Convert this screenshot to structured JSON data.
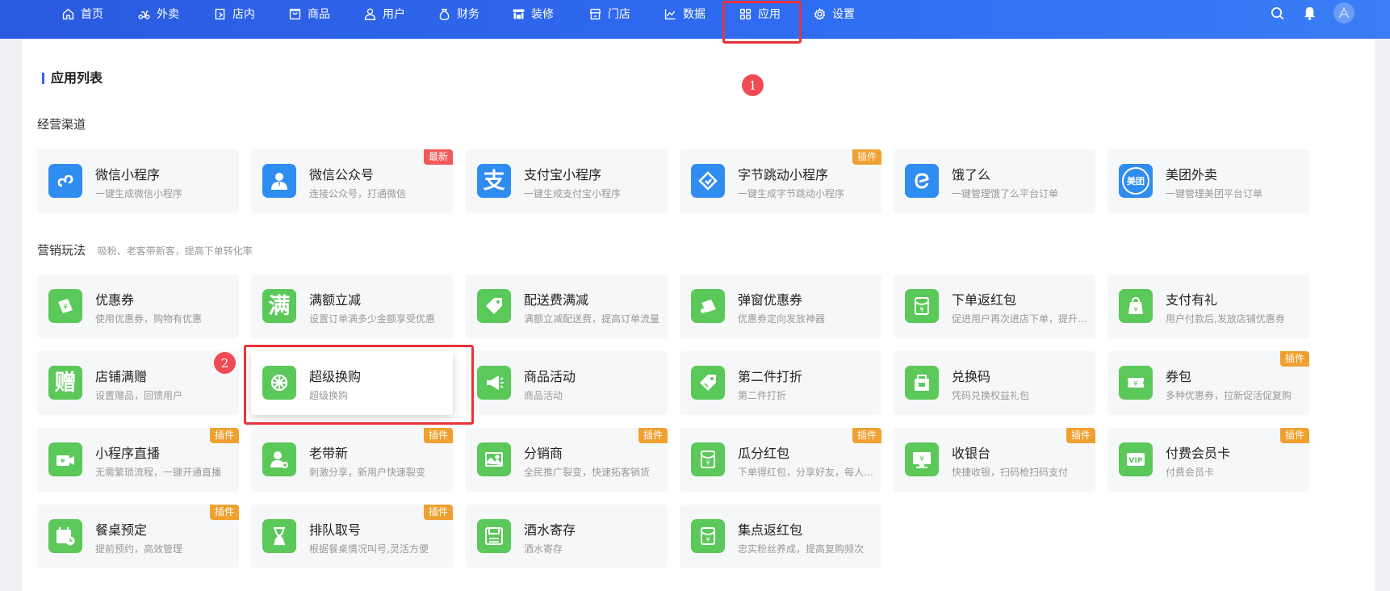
{
  "colors": {
    "nav_bg": "#2f6df2",
    "accent": "#2d66f0",
    "icon_green": "#5bc85a",
    "icon_blue": "#2f8cf0",
    "plugin_badge": "#f0a030",
    "new_badge": "#f05a5a",
    "highlight": "#e8333a"
  },
  "nav": {
    "items": [
      {
        "label": "首页",
        "icon": "home-icon"
      },
      {
        "label": "外卖",
        "icon": "scooter-icon"
      },
      {
        "label": "店内",
        "icon": "store-door-icon"
      },
      {
        "label": "商品",
        "icon": "bag-icon"
      },
      {
        "label": "用户",
        "icon": "user-icon"
      },
      {
        "label": "财务",
        "icon": "money-bag-icon"
      },
      {
        "label": "装修",
        "icon": "shop-decor-icon"
      },
      {
        "label": "门店",
        "icon": "shop-icon"
      },
      {
        "label": "数据",
        "icon": "chart-icon"
      },
      {
        "label": "应用",
        "icon": "apps-grid-icon"
      },
      {
        "label": "设置",
        "icon": "gear-icon"
      }
    ],
    "right_icons": [
      "search-icon",
      "bell-icon",
      "avatar"
    ]
  },
  "steps": [
    "1",
    "2"
  ],
  "page": {
    "title": "应用列表"
  },
  "groups": {
    "channels": {
      "title": "经营渠道",
      "subtitle": "",
      "items": [
        {
          "name": "微信小程序",
          "desc": "一键生成微信小程序",
          "icon": "mini-program-icon",
          "badge": ""
        },
        {
          "name": "微信公众号",
          "desc": "连接公众号，打通微信",
          "icon": "official-account-icon",
          "badge": "最新"
        },
        {
          "name": "支付宝小程序",
          "desc": "一键生成支付宝小程序",
          "icon": "alipay-icon",
          "icon_text": "支",
          "badge": ""
        },
        {
          "name": "字节跳动小程序",
          "desc": "一键生成字节跳动小程序",
          "icon": "bytedance-icon",
          "badge": "插件"
        },
        {
          "name": "饿了么",
          "desc": "一键管理饿了么平台订单",
          "icon": "eleme-icon",
          "badge": ""
        },
        {
          "name": "美团外卖",
          "desc": "一键管理美团平台订单",
          "icon": "meituan-icon",
          "icon_text": "美团",
          "badge": ""
        }
      ]
    },
    "marketing": {
      "title": "营销玩法",
      "subtitle": "吸粉、老客带新客，提高下单转化率",
      "items": [
        {
          "name": "优惠券",
          "desc": "使用优惠券，购物有优惠",
          "icon": "coupon-icon",
          "badge": ""
        },
        {
          "name": "满额立减",
          "desc": "设置订单满多少金额享受优惠",
          "icon": "full-reduction-icon",
          "icon_text": "满",
          "badge": ""
        },
        {
          "name": "配送费满减",
          "desc": "满额立减配送费，提高订单流量",
          "icon": "delivery-tag-icon",
          "badge": ""
        },
        {
          "name": "弹窗优惠券",
          "desc": "优惠券定向发放神器",
          "icon": "popup-coupon-icon",
          "badge": ""
        },
        {
          "name": "下单返红包",
          "desc": "促进用户再次进店下单，提升复购",
          "icon": "red-envelope-icon",
          "badge": ""
        },
        {
          "name": "支付有礼",
          "desc": "用户付款后,发放店铺优惠券",
          "icon": "gift-bag-icon",
          "badge": ""
        },
        {
          "name": "店铺满赠",
          "desc": "设置赠品，回馈用户",
          "icon": "gift-text-icon",
          "icon_text": "赠",
          "badge": ""
        },
        {
          "name": "超级换购",
          "desc": "超级换购",
          "icon": "wheel-icon",
          "badge": ""
        },
        {
          "name": "商品活动",
          "desc": "商品活动",
          "icon": "megaphone-icon",
          "badge": ""
        },
        {
          "name": "第二件打折",
          "desc": "第二件打折",
          "icon": "price-tag-icon",
          "badge": ""
        },
        {
          "name": "兑换码",
          "desc": "凭码兑换权益礼包",
          "icon": "redeem-box-icon",
          "badge": ""
        },
        {
          "name": "券包",
          "desc": "多种优惠券，拉新促活促复购",
          "icon": "coupon-pack-icon",
          "badge": "插件"
        },
        {
          "name": "小程序直播",
          "desc": "无需繁琐流程，一键开通直播",
          "icon": "live-video-icon",
          "badge": "插件"
        },
        {
          "name": "老带新",
          "desc": "刺激分享，新用户快速裂变",
          "icon": "invite-user-icon",
          "badge": "插件"
        },
        {
          "name": "分销商",
          "desc": "全民推广裂变，快速拓客销货",
          "icon": "image-share-icon",
          "badge": "插件"
        },
        {
          "name": "瓜分红包",
          "desc": "下单得红包，分享好友，每人都能得",
          "icon": "split-envelope-icon",
          "badge": "插件"
        },
        {
          "name": "收银台",
          "desc": "快捷收银，扫码枪扫码支付",
          "icon": "cashier-monitor-icon",
          "badge": "插件"
        },
        {
          "name": "付费会员卡",
          "desc": "付费会员卡",
          "icon": "vip-card-icon",
          "badge": "插件"
        },
        {
          "name": "餐桌预定",
          "desc": "提前预约，高效管理",
          "icon": "calendar-clock-icon",
          "badge": "插件"
        },
        {
          "name": "排队取号",
          "desc": "根据餐桌情况叫号,灵活方便",
          "icon": "hourglass-icon",
          "badge": "插件"
        },
        {
          "name": "酒水寄存",
          "desc": "酒水寄存",
          "icon": "storage-box-icon",
          "badge": ""
        },
        {
          "name": "集点返红包",
          "desc": "忠实粉丝养成，提高复购频次",
          "icon": "points-envelope-icon",
          "badge": ""
        }
      ]
    }
  }
}
